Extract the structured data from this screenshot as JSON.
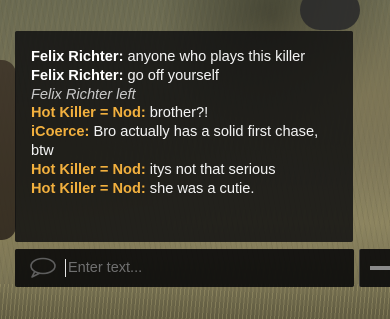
{
  "chat": {
    "messages": [
      {
        "sender": "Felix Richter:",
        "text": " anyone who plays this killer",
        "sender_color": "#ffffff"
      },
      {
        "sender": "Felix Richter:",
        "text": " go off yourself",
        "sender_color": "#ffffff"
      },
      {
        "system": "Felix Richter left"
      },
      {
        "sender": "Hot Killer = Nod:",
        "text": " brother?!",
        "sender_color": "#f2b03e"
      },
      {
        "sender": "iCoerce:",
        "text": " Bro actually has a solid first chase, btw",
        "sender_color": "#f2b03e"
      },
      {
        "sender": "Hot Killer = Nod:",
        "text": " itys not that serious",
        "sender_color": "#f2b03e"
      },
      {
        "sender": "Hot Killer = Nod:",
        "text": " she was a cutie.",
        "sender_color": "#f2b03e"
      }
    ]
  },
  "input": {
    "placeholder": "Enter text...",
    "icon": "chat-bubble-icon"
  },
  "colors": {
    "panel_bg": "#121212",
    "player_name": "#ffffff",
    "killer_name": "#f2b03e",
    "system_text": "#c8c8c8"
  }
}
